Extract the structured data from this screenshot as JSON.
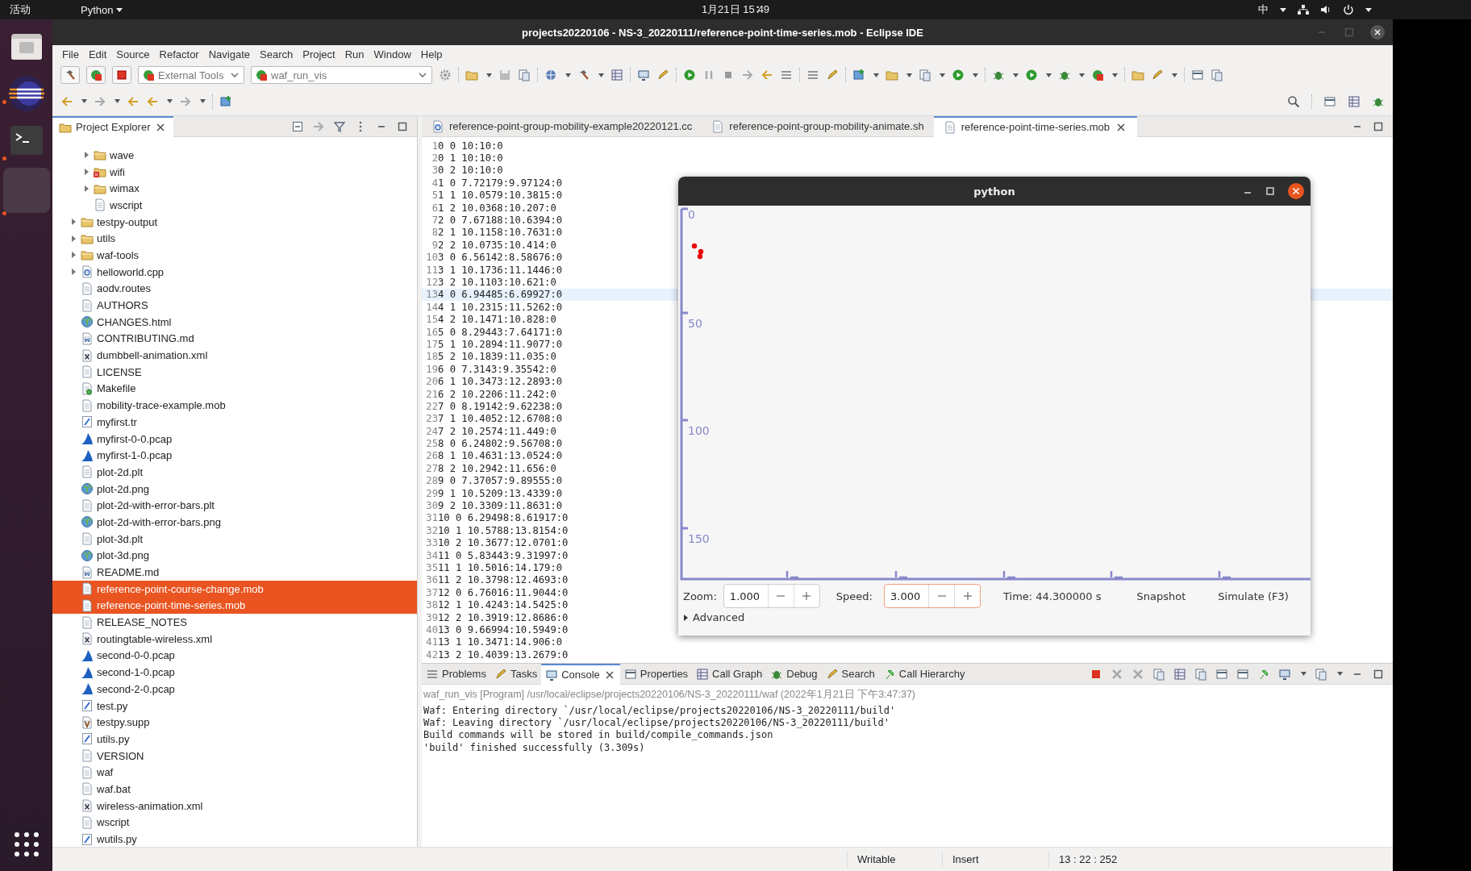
{
  "top_bar": {
    "activities": "活动",
    "app_menu": "Python",
    "clock": "1月21日 15∶49",
    "input_method": "中"
  },
  "window": {
    "title": "projects20220106 - NS-3_20220111/reference-point-time-series.mob - Eclipse IDE"
  },
  "menu": [
    "File",
    "Edit",
    "Source",
    "Refactor",
    "Navigate",
    "Search",
    "Project",
    "Run",
    "Window",
    "Help"
  ],
  "toolbar": {
    "external_tools": "External Tools",
    "launch_config": "waf_run_vis"
  },
  "project_explorer": {
    "title": "Project Explorer",
    "tree": [
      {
        "children": [
          {
            "label": "wave",
            "kind": "folder",
            "expanded": false,
            "selected": false
          },
          {
            "label": "wifi",
            "kind": "folder-error",
            "expanded": false,
            "selected": false
          },
          {
            "label": "wimax",
            "kind": "folder",
            "expanded": false,
            "selected": false
          },
          {
            "label": "wscript",
            "kind": "file",
            "selected": false
          }
        ]
      },
      {
        "label": "testpy-output",
        "kind": "folder",
        "expanded": false,
        "selected": false
      },
      {
        "label": "utils",
        "kind": "folder",
        "expanded": false,
        "selected": false
      },
      {
        "label": "waf-tools",
        "kind": "folder",
        "expanded": false,
        "selected": false
      },
      {
        "label": "helloworld.cpp",
        "kind": "source",
        "expanded": false,
        "selected": false
      },
      {
        "label": "aodv.routes",
        "kind": "file",
        "selected": false
      },
      {
        "label": "AUTHORS",
        "kind": "file",
        "selected": false
      },
      {
        "label": "CHANGES.html",
        "kind": "globe",
        "selected": false
      },
      {
        "label": "CONTRIBUTING.md",
        "kind": "doc",
        "selected": false
      },
      {
        "label": "dumbbell-animation.xml",
        "kind": "xml",
        "selected": false
      },
      {
        "label": "LICENSE",
        "kind": "file",
        "selected": false
      },
      {
        "label": "Makefile",
        "kind": "make",
        "selected": false
      },
      {
        "label": "mobility-trace-example.mob",
        "kind": "file",
        "selected": false
      },
      {
        "label": "myfirst.tr",
        "kind": "script",
        "selected": false
      },
      {
        "label": "myfirst-0-0.pcap",
        "kind": "fin",
        "selected": false
      },
      {
        "label": "myfirst-1-0.pcap",
        "kind": "fin",
        "selected": false
      },
      {
        "label": "plot-2d.plt",
        "kind": "file",
        "selected": false
      },
      {
        "label": "plot-2d.png",
        "kind": "globe",
        "selected": false
      },
      {
        "label": "plot-2d-with-error-bars.plt",
        "kind": "file",
        "selected": false
      },
      {
        "label": "plot-2d-with-error-bars.png",
        "kind": "globe",
        "selected": false
      },
      {
        "label": "plot-3d.plt",
        "kind": "file",
        "selected": false
      },
      {
        "label": "plot-3d.png",
        "kind": "globe",
        "selected": false
      },
      {
        "label": "README.md",
        "kind": "doc",
        "selected": false
      },
      {
        "label": "reference-point-course-change.mob",
        "kind": "file",
        "selected": true
      },
      {
        "label": "reference-point-time-series.mob",
        "kind": "file",
        "selected": true
      },
      {
        "label": "RELEASE_NOTES",
        "kind": "file",
        "selected": false
      },
      {
        "label": "routingtable-wireless.xml",
        "kind": "xml",
        "selected": false
      },
      {
        "label": "second-0-0.pcap",
        "kind": "fin",
        "selected": false
      },
      {
        "label": "second-1-0.pcap",
        "kind": "fin",
        "selected": false
      },
      {
        "label": "second-2-0.pcap",
        "kind": "fin",
        "selected": false
      },
      {
        "label": "test.py",
        "kind": "script",
        "selected": false
      },
      {
        "label": "testpy.supp",
        "kind": "vfile",
        "selected": false
      },
      {
        "label": "utils.py",
        "kind": "script",
        "selected": false
      },
      {
        "label": "VERSION",
        "kind": "file",
        "selected": false
      },
      {
        "label": "waf",
        "kind": "file",
        "selected": false
      },
      {
        "label": "waf.bat",
        "kind": "file",
        "selected": false
      },
      {
        "label": "wireless-animation.xml",
        "kind": "xml",
        "selected": false
      },
      {
        "label": "wscript",
        "kind": "file",
        "selected": false
      },
      {
        "label": "wutils.py",
        "kind": "script",
        "selected": false
      }
    ]
  },
  "editor": {
    "tabs": [
      {
        "label": "reference-point-group-mobility-example20220121.cc",
        "kind": "source",
        "selected": false
      },
      {
        "label": "reference-point-group-mobility-animate.sh",
        "kind": "file",
        "selected": false
      },
      {
        "label": "reference-point-time-series.mob",
        "kind": "file",
        "selected": true
      }
    ],
    "lines": [
      {
        "number": "1",
        "text": "0 0 10:10:0",
        "current": false
      },
      {
        "number": "2",
        "text": "0 1 10:10:0",
        "current": false
      },
      {
        "number": "3",
        "text": "0 2 10:10:0",
        "current": false
      },
      {
        "number": "4",
        "text": "1 0 7.72179:9.97124:0",
        "current": false
      },
      {
        "number": "5",
        "text": "1 1 10.0579:10.3815:0",
        "current": false
      },
      {
        "number": "6",
        "text": "1 2 10.0368:10.207:0",
        "current": false
      },
      {
        "number": "7",
        "text": "2 0 7.67188:10.6394:0",
        "current": false
      },
      {
        "number": "8",
        "text": "2 1 10.1158:10.7631:0",
        "current": false
      },
      {
        "number": "9",
        "text": "2 2 10.0735:10.414:0",
        "current": false
      },
      {
        "number": "10",
        "text": "3 0 6.56142:8.58676:0",
        "current": false
      },
      {
        "number": "11",
        "text": "3 1 10.1736:11.1446:0",
        "current": false
      },
      {
        "number": "12",
        "text": "3 2 10.1103:10.621:0",
        "current": false
      },
      {
        "number": "13",
        "text": "4 0 6.94485:6.69927:0",
        "current": true
      },
      {
        "number": "14",
        "text": "4 1 10.2315:11.5262:0",
        "current": false
      },
      {
        "number": "15",
        "text": "4 2 10.1471:10.828:0",
        "current": false
      },
      {
        "number": "16",
        "text": "5 0 8.29443:7.64171:0",
        "current": false
      },
      {
        "number": "17",
        "text": "5 1 10.2894:11.9077:0",
        "current": false
      },
      {
        "number": "18",
        "text": "5 2 10.1839:11.035:0",
        "current": false
      },
      {
        "number": "19",
        "text": "6 0 7.3143:9.35542:0",
        "current": false
      },
      {
        "number": "20",
        "text": "6 1 10.3473:12.2893:0",
        "current": false
      },
      {
        "number": "21",
        "text": "6 2 10.2206:11.242:0",
        "current": false
      },
      {
        "number": "22",
        "text": "7 0 8.19142:9.62238:0",
        "current": false
      },
      {
        "number": "23",
        "text": "7 1 10.4052:12.6708:0",
        "current": false
      },
      {
        "number": "24",
        "text": "7 2 10.2574:11.449:0",
        "current": false
      },
      {
        "number": "25",
        "text": "8 0 6.24802:9.56708:0",
        "current": false
      },
      {
        "number": "26",
        "text": "8 1 10.4631:13.0524:0",
        "current": false
      },
      {
        "number": "27",
        "text": "8 2 10.2942:11.656:0",
        "current": false
      },
      {
        "number": "28",
        "text": "9 0 7.37057:9.89555:0",
        "current": false
      },
      {
        "number": "29",
        "text": "9 1 10.5209:13.4339:0",
        "current": false
      },
      {
        "number": "30",
        "text": "9 2 10.3309:11.8631:0",
        "current": false
      },
      {
        "number": "31",
        "text": "10 0 6.29498:8.61917:0",
        "current": false
      },
      {
        "number": "32",
        "text": "10 1 10.5788:13.8154:0",
        "current": false
      },
      {
        "number": "33",
        "text": "10 2 10.3677:12.0701:0",
        "current": false
      },
      {
        "number": "34",
        "text": "11 0 5.83443:9.31997:0",
        "current": false
      },
      {
        "number": "35",
        "text": "11 1 10.5016:14.179:0",
        "current": false
      },
      {
        "number": "36",
        "text": "11 2 10.3798:12.4693:0",
        "current": false
      },
      {
        "number": "37",
        "text": "12 0 6.76016:11.9044:0",
        "current": false
      },
      {
        "number": "38",
        "text": "12 1 10.4243:14.5425:0",
        "current": false
      },
      {
        "number": "39",
        "text": "12 2 10.3919:12.8686:0",
        "current": false
      },
      {
        "number": "40",
        "text": "13 0 9.66994:10.5949:0",
        "current": false
      },
      {
        "number": "41",
        "text": "13 1 10.3471:14.906:0",
        "current": false
      },
      {
        "number": "42",
        "text": "13 2 10.4039:13.2679:0",
        "current": false
      }
    ]
  },
  "python_window": {
    "title": "python",
    "y_ticks": [
      "0",
      "50",
      "100",
      "150"
    ],
    "zoom_label": "Zoom:",
    "zoom_value": "1.000",
    "speed_label": "Speed:",
    "speed_value": "3.000",
    "speed_focused": true,
    "time": "Time: 44.300000 s",
    "snapshot": "Snapshot",
    "simulate": "Simulate (F3)",
    "advanced": "Advanced",
    "advanced_expanded": false
  },
  "bottom_panel": {
    "tabs": [
      {
        "label": "Problems",
        "kind": "problems",
        "selected": false
      },
      {
        "label": "Tasks",
        "kind": "tasks",
        "selected": false
      },
      {
        "label": "Console",
        "kind": "console",
        "selected": true
      },
      {
        "label": "Properties",
        "kind": "properties",
        "selected": false
      },
      {
        "label": "Call Graph",
        "kind": "graph",
        "selected": false
      },
      {
        "label": "Debug",
        "kind": "debug",
        "selected": false
      },
      {
        "label": "Search",
        "kind": "search",
        "selected": false
      },
      {
        "label": "Call Hierarchy",
        "kind": "hierarchy",
        "selected": false
      }
    ],
    "console_header": "waf_run_vis [Program] /usr/local/eclipse/projects20220106/NS-3_20220111/waf (2022年1月21日 下午3:47:37)",
    "console_lines": [
      "Waf: Entering directory `/usr/local/eclipse/projects20220106/NS-3_20220111/build'",
      "Waf: Leaving directory `/usr/local/eclipse/projects20220106/NS-3_20220111/build'",
      "Build commands will be stored in build/compile_commands.json",
      "'build' finished successfully (3.309s)"
    ]
  },
  "status_bar": {
    "mode": "Writable",
    "insert": "Insert",
    "position": "13 : 22 : 252"
  }
}
